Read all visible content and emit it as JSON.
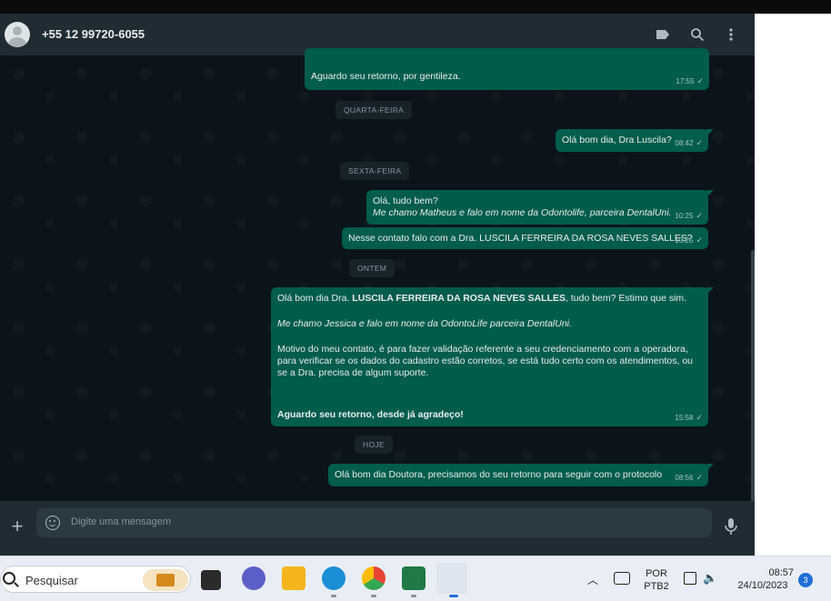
{
  "header": {
    "contact_name": "+55 12 99720-6055",
    "icons": [
      "avatar",
      "label-icon",
      "search-icon",
      "more-menu-icon"
    ]
  },
  "messages": [
    {
      "type": "out",
      "text": "Aguardo seu retorno, por gentileza.",
      "time": "17:55"
    },
    {
      "type": "day",
      "text": "QUARTA-FEIRA"
    },
    {
      "type": "out",
      "text": "Olá bom dia, Dra Luscila?",
      "time": "08:42"
    },
    {
      "type": "day",
      "text": "SEXTA-FEIRA"
    },
    {
      "type": "out",
      "line1": "Olá, tudo bem?",
      "line2": "Me chamo Matheus e falo em nome da Odontolife, parceira DentalUni.",
      "time": "10:25"
    },
    {
      "type": "out",
      "text": "Nesse contato falo com a Dra. LUSCILA FERREIRA DA ROSA NEVES SALLES?",
      "time": "10:25"
    },
    {
      "type": "day",
      "text": "ONTEM"
    },
    {
      "type": "out",
      "p1_pre": "Olá bom dia Dra. ",
      "p1_bold": "LUSCILA FERREIRA DA ROSA NEVES SALLES",
      "p1_post": ", tudo bem? Estimo que sim.",
      "p2": "Me chamo Jessica e falo em nome da OdontoLife parceira DentalUni.",
      "p3": "Motivo do meu contato, é para fazer validação referente a seu credenciamento com a operadora, para verificar se os dados do cadastro estão corretos, se está tudo certo com os atendimentos, ou se a Dra. precisa de algum suporte.",
      "p4": "Aguardo seu retorno, desde já agradeço!",
      "time": "15:58"
    },
    {
      "type": "day",
      "text": "HOJE"
    },
    {
      "type": "out",
      "text": "Olá bom dia Doutora, precisamos do seu retorno para seguir com o protocolo",
      "time": "08:56"
    }
  ],
  "compose": {
    "placeholder": "Digite uma mensagem"
  },
  "taskbar": {
    "search_label": "Pesquisar",
    "lang_line1": "POR",
    "lang_line2": "PTB2",
    "time": "08:57",
    "date": "24/10/2023",
    "notification_count": "3"
  },
  "colors": {
    "header_bg": "#202c33",
    "chat_bg": "#0b141a",
    "outgoing_bubble": "#005c4b",
    "day_separator": "#182229",
    "taskbar_bg": "#e9eef6"
  }
}
